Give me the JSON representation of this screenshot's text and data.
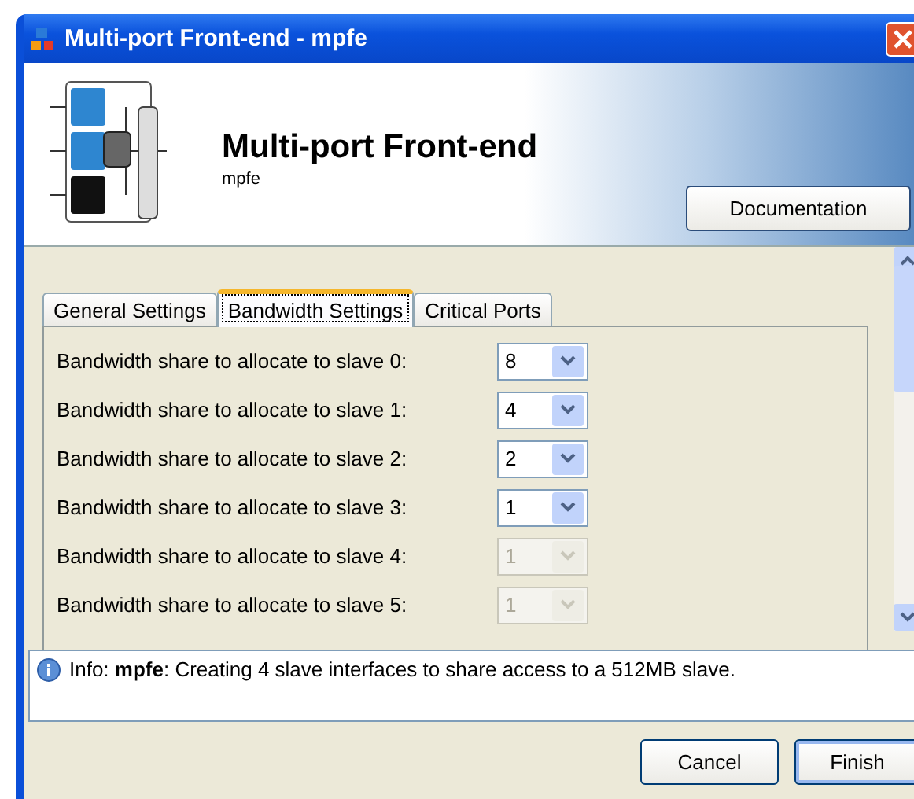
{
  "window": {
    "title": "Multi-port Front-end - mpfe"
  },
  "header": {
    "title": "Multi-port Front-end",
    "subtitle": "mpfe",
    "button": "Documentation"
  },
  "tabs": [
    {
      "label": "General Settings",
      "selected": false
    },
    {
      "label": "Bandwidth Settings",
      "selected": true
    },
    {
      "label": "Critical Ports",
      "selected": false
    }
  ],
  "settings": [
    {
      "label": "Bandwidth share to allocate to slave 0:",
      "value": "8",
      "disabled": false
    },
    {
      "label": "Bandwidth share to allocate to slave 1:",
      "value": "4",
      "disabled": false
    },
    {
      "label": "Bandwidth share to allocate to slave 2:",
      "value": "2",
      "disabled": false
    },
    {
      "label": "Bandwidth share to allocate to slave 3:",
      "value": "1",
      "disabled": false
    },
    {
      "label": "Bandwidth share to allocate to slave 4:",
      "value": "1",
      "disabled": true
    },
    {
      "label": "Bandwidth share to allocate to slave 5:",
      "value": "1",
      "disabled": true
    }
  ],
  "message": {
    "text": "Info: **mpfe**: Creating 4 slave interfaces to share access to a 512MB slave."
  },
  "buttons": [
    "Cancel",
    "Finish"
  ]
}
